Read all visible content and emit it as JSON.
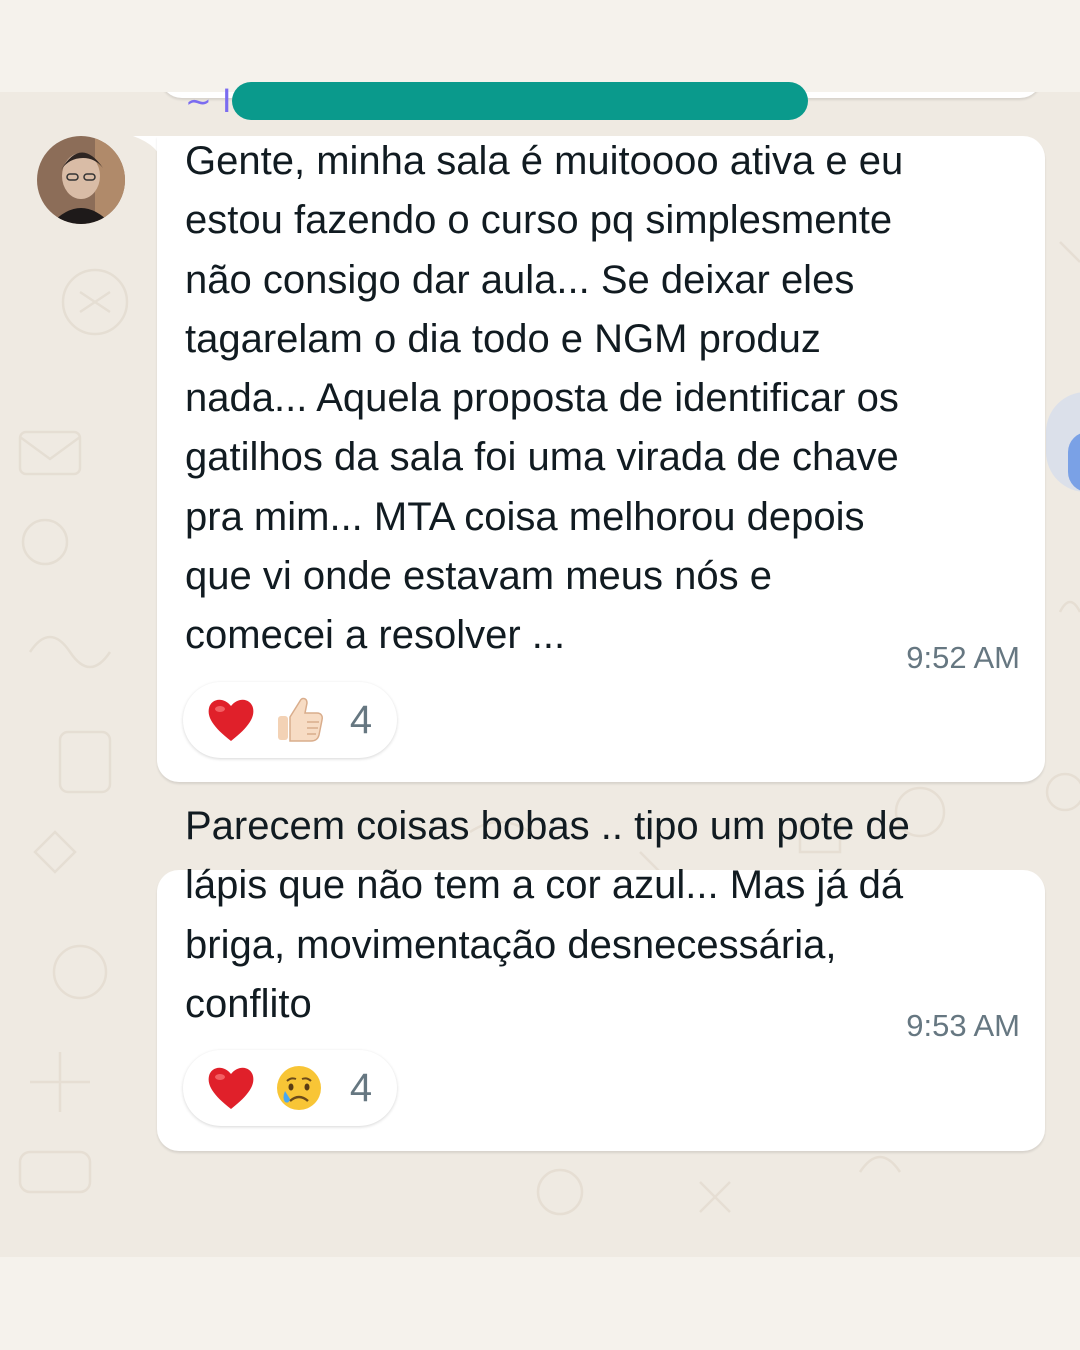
{
  "chat": {
    "messages": [
      {
        "sender_prefix": "~ I",
        "sender_name_redacted": true,
        "lines": [
          "Gente, minha sala é muitoooo ativa e eu",
          "estou fazendo o curso pq simplesmente",
          "não consigo dar aula... Se deixar eles",
          "tagarelam o dia todo e NGM produz",
          "nada... Aquela proposta de identificar os",
          "gatilhos da sala foi uma virada de chave",
          "pra mim... MTA coisa melhorou depois",
          "que vi onde estavam meus nós e",
          "comecei a resolver ..."
        ],
        "time": "9:52 AM",
        "reactions": {
          "emojis": [
            "heart-emoji",
            "thumbs-up-emoji"
          ],
          "count": "4"
        }
      },
      {
        "lines": [
          "Parecem coisas bobas .. tipo um pote de",
          "lápis que não tem a cor azul... Mas já dá",
          "briga, movimentação desnecessária,",
          "conflito"
        ],
        "time": "9:53 AM",
        "reactions": {
          "emojis": [
            "heart-emoji",
            "crying-face-emoji"
          ],
          "count": "4"
        }
      }
    ]
  },
  "colors": {
    "background": "#efeae2",
    "frame": "#f5f2ec",
    "bubble": "#ffffff",
    "text": "#111b21",
    "meta": "#667781",
    "sender": "#7b6cf0",
    "redaction": "#0a9a8c"
  }
}
